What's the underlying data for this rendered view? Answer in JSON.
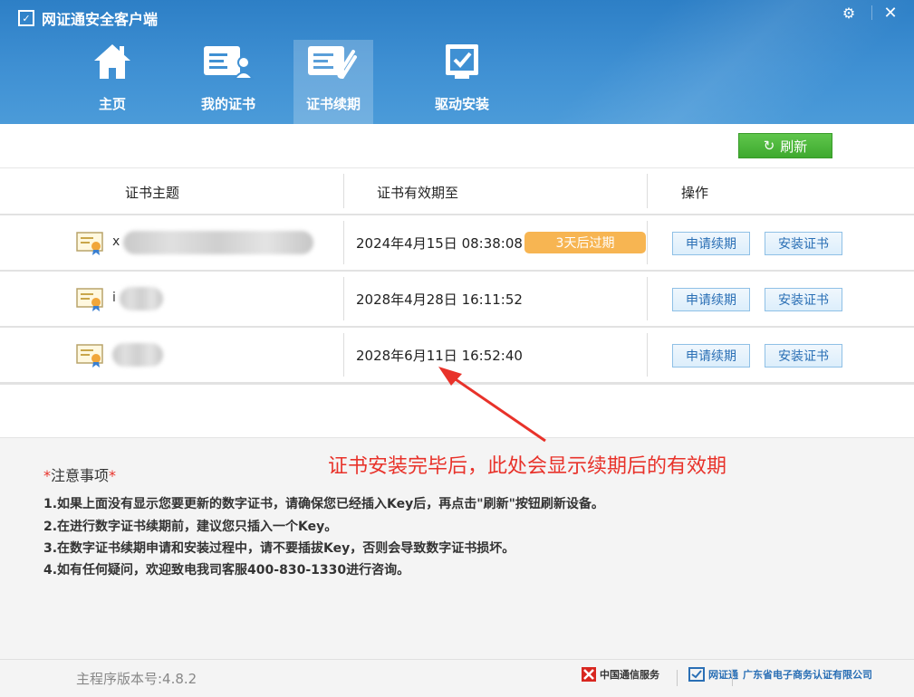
{
  "app": {
    "title": "网证通安全客户端"
  },
  "nav": {
    "tabs": [
      {
        "label": "主页",
        "icon": "home-icon"
      },
      {
        "label": "我的证书",
        "icon": "certificate-card-icon"
      },
      {
        "label": "证书续期",
        "icon": "renew-certificate-icon",
        "active": true
      },
      {
        "label": "驱动安装",
        "icon": "driver-checkbox-icon"
      }
    ]
  },
  "toolbar": {
    "refresh_label": "刷新"
  },
  "table": {
    "columns": [
      "证书主题",
      "证书有效期至",
      "操作"
    ],
    "rows": [
      {
        "subject": "x",
        "expiry": "2024年4月15日 08:38:08",
        "badge": "3天后过期"
      },
      {
        "subject": "i",
        "expiry": "2028年4月28日 16:11:52",
        "badge": ""
      },
      {
        "subject": "",
        "expiry": "2028年6月11日 16:52:40",
        "badge": ""
      }
    ],
    "renew_label": "申请续期",
    "install_label": "安装证书"
  },
  "annotation": "证书安装完毕后，此处会显示续期后的有效期",
  "notes": {
    "title": "注意事项",
    "items": [
      "1.如果上面没有显示您要更新的数字证书，请确保您已经插入Key后，再点击\"刷新\"按钮刷新设备。",
      "2.在进行数字证书续期前，建议您只插入一个Key。",
      "3.在数字证书续期申请和安装过程中，请不要插拔Key，否则会导致数字证书损坏。",
      "4.如有任何疑问，欢迎致电我司客服400-830-1330进行咨询。"
    ]
  },
  "footer": {
    "version": "主程序版本号:4.8.2",
    "partners": [
      "中国通信服务",
      "网证通",
      "广东省电子商务认证有限公司"
    ]
  },
  "colors": {
    "header": "#3f90d3",
    "refresh": "#4cb83a",
    "badge": "#f7b552",
    "annotation": "#e8322a",
    "link_text": "#2a6fb5"
  }
}
